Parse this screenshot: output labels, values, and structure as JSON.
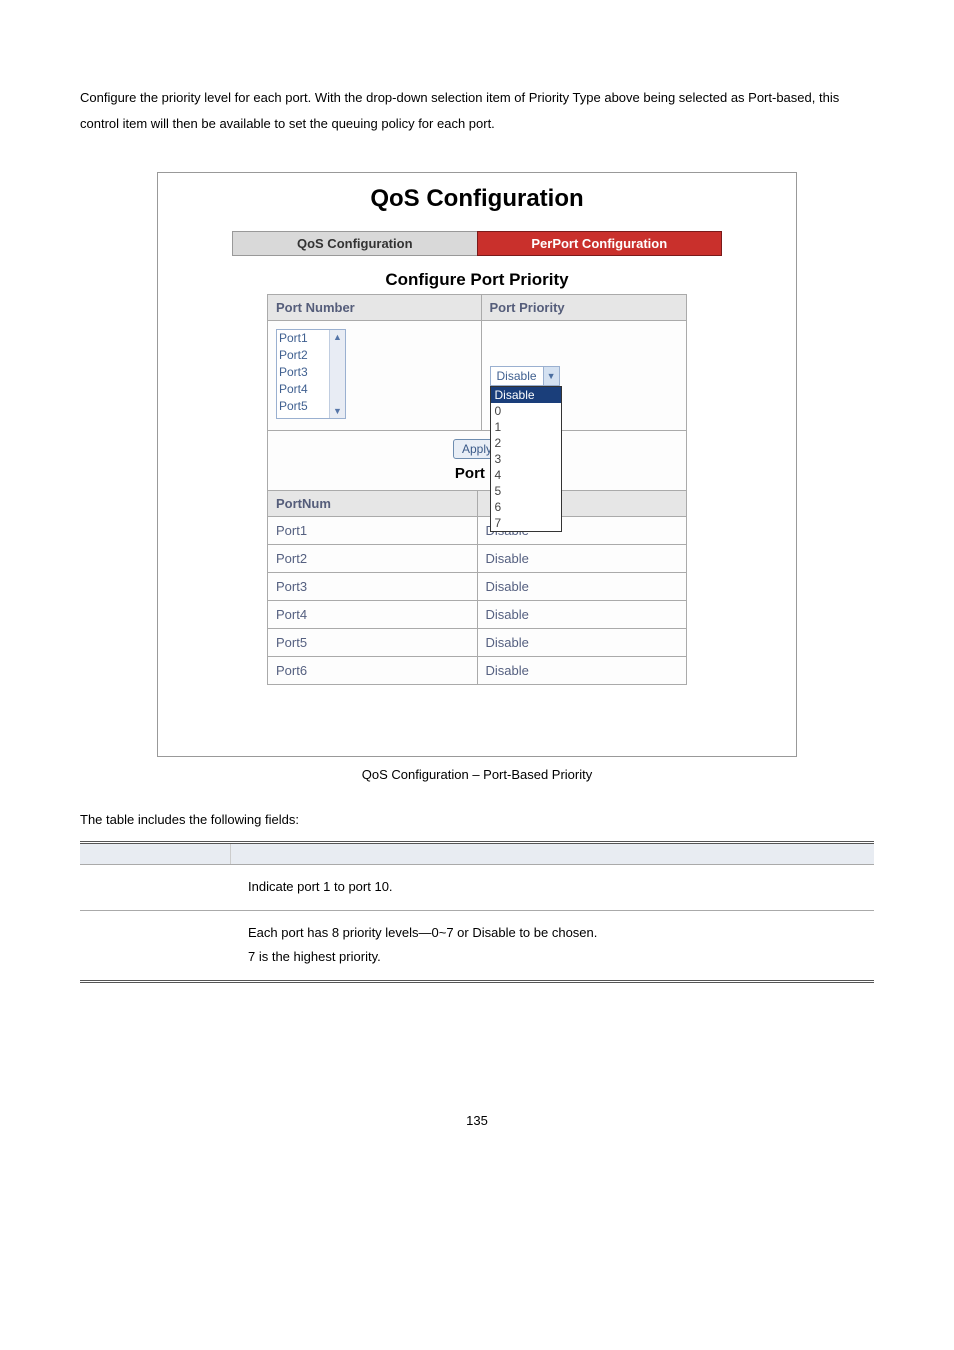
{
  "intro": "Configure the priority level for each port. With the drop-down selection item of Priority Type above being selected as Port-based, this control item will then be available to set the queuing policy for each port.",
  "panel": {
    "title": "QoS Configuration",
    "tabs": {
      "inactive": "QoS Configuration",
      "active": "PerPort Configuration"
    },
    "subheading": "Configure Port Priority",
    "col1": "Port Number",
    "col2": "Port Priority",
    "ports_list": [
      "Port1",
      "Port2",
      "Port3",
      "Port4",
      "Port5"
    ],
    "dropdown": {
      "selected": "Disable",
      "options": [
        "Disable",
        "0",
        "1",
        "2",
        "3",
        "4",
        "5",
        "6",
        "7"
      ]
    },
    "apply": "Apply",
    "port_p_label": "Port P",
    "priority_header1": "PortNum",
    "rows": [
      {
        "port": "Port1",
        "priority": "Disable"
      },
      {
        "port": "Port2",
        "priority": "Disable"
      },
      {
        "port": "Port3",
        "priority": "Disable"
      },
      {
        "port": "Port4",
        "priority": "Disable"
      },
      {
        "port": "Port5",
        "priority": "Disable"
      },
      {
        "port": "Port6",
        "priority": "Disable"
      }
    ]
  },
  "caption": "QoS Configuration – Port-Based Priority",
  "table_intro": "The table includes the following fields:",
  "fields": [
    {
      "desc": "Indicate port 1 to port 10."
    },
    {
      "desc": "Each port has 8 priority levels—0~7 or Disable to be chosen.\n7 is the highest priority."
    }
  ],
  "page_num": "135"
}
